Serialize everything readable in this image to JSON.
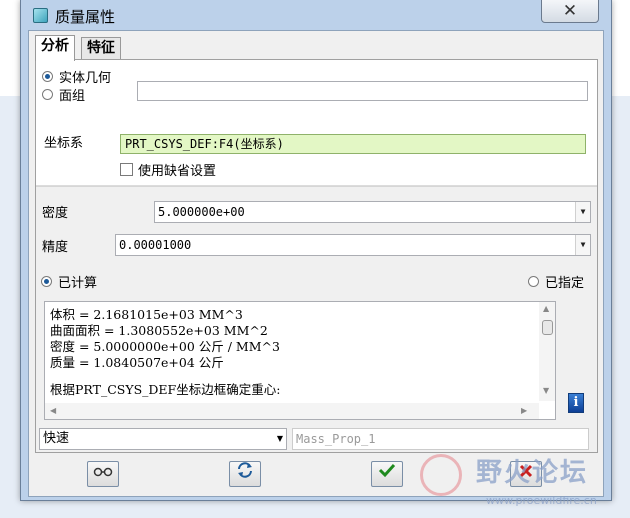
{
  "window": {
    "title": "质量属性",
    "close_glyph": "✕"
  },
  "tabs": [
    {
      "label": "分析",
      "active": true
    },
    {
      "label": "特征",
      "active": false
    }
  ],
  "geometry": {
    "options": [
      {
        "label": "实体几何",
        "checked": true
      },
      {
        "label": "面组",
        "checked": false
      }
    ],
    "quilt_value": ""
  },
  "coordsys": {
    "label": "坐标系",
    "value": "PRT_CSYS_DEF:F4(坐标系)",
    "default_label": "使用缺省设置",
    "default_checked": false
  },
  "density": {
    "label": "密度",
    "value": "5.000000e+00"
  },
  "accuracy": {
    "label": "精度",
    "value": "0.00001000"
  },
  "mode": {
    "computed_label": "已计算",
    "computed_checked": true,
    "assigned_label": "已指定",
    "assigned_checked": false
  },
  "results": {
    "lines": [
      "体积 =  2.1681015e+03  MM^3",
      "曲面面积 =  1.3080552e+03  MM^2",
      "密度 =  5.0000000e+00 公斤 / MM^3",
      "质量 =  1.0840507e+04 公斤",
      "",
      "根据PRT_CSYS_DEF坐标边框确定重心:"
    ]
  },
  "calc_mode": {
    "value": "快速"
  },
  "feature_name": {
    "value": "Mass_Prop_1"
  },
  "toolbar": {
    "preview_icon": "glasses-icon",
    "repeat_icon": "repeat-icon",
    "ok_icon": "checkmark-icon",
    "cancel_icon": "cancel-icon"
  },
  "watermark": {
    "text": "野火论坛",
    "url": "www.proewildfire.cn"
  },
  "colors": {
    "accent": "#1d5a99",
    "coord_bg": "#e3f7c5",
    "ok_green": "#1f8a1f",
    "cancel_red": "#c82020"
  }
}
